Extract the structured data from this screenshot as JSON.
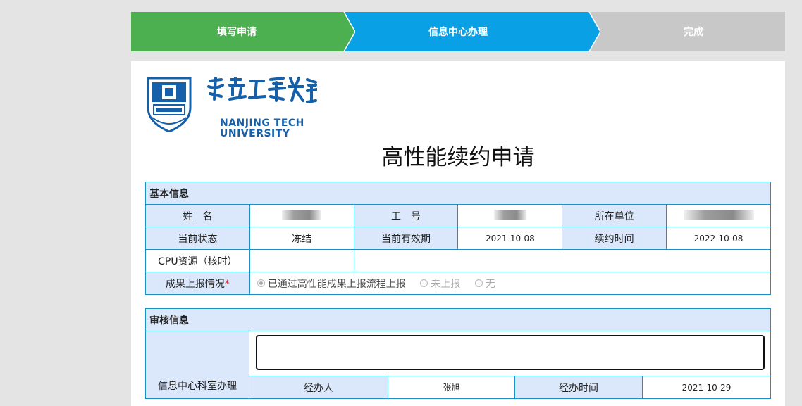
{
  "stepper": {
    "steps": [
      {
        "label": "填写申请",
        "state": "done",
        "color": "#4cb050"
      },
      {
        "label": "信息中心办理",
        "state": "active",
        "color": "#0aa0e6"
      },
      {
        "label": "完成",
        "state": "pending",
        "color": "#c8c8c8"
      }
    ]
  },
  "logo": {
    "en_line1": "NANJING TECH",
    "en_line2": "UNIVERSITY",
    "icon": "nanjing-tech-seal-icon"
  },
  "form": {
    "title": "高性能续约申请",
    "basic": {
      "section_title": "基本信息",
      "name_label": "姓　名",
      "id_label": "工　号",
      "unit_label": "所在单位",
      "status_label": "当前状态",
      "status_value": "冻结",
      "valid_label": "当前有效期",
      "valid_value": "2021-10-08",
      "renew_label": "续约时间",
      "renew_value": "2022-10-08",
      "cpu_label": "CPU资源（核时）",
      "cpu_value": "",
      "report_label": "成果上报情况",
      "report_required": "*",
      "report_options": [
        "已通过高性能成果上报流程上报",
        "未上报",
        "无"
      ],
      "report_selected": "已通过高性能成果上报流程上报"
    },
    "review": {
      "section_title": "审核信息",
      "office_label": "信息中心科室办理",
      "office_value": "",
      "handler_label": "经办人",
      "handler_value": "张旭",
      "time_label": "经办时间",
      "time_value": "2021-10-29"
    }
  },
  "colors": {
    "border": "#1e90c8",
    "header_bg": "#dbe8fb",
    "brand": "#1560a8"
  }
}
